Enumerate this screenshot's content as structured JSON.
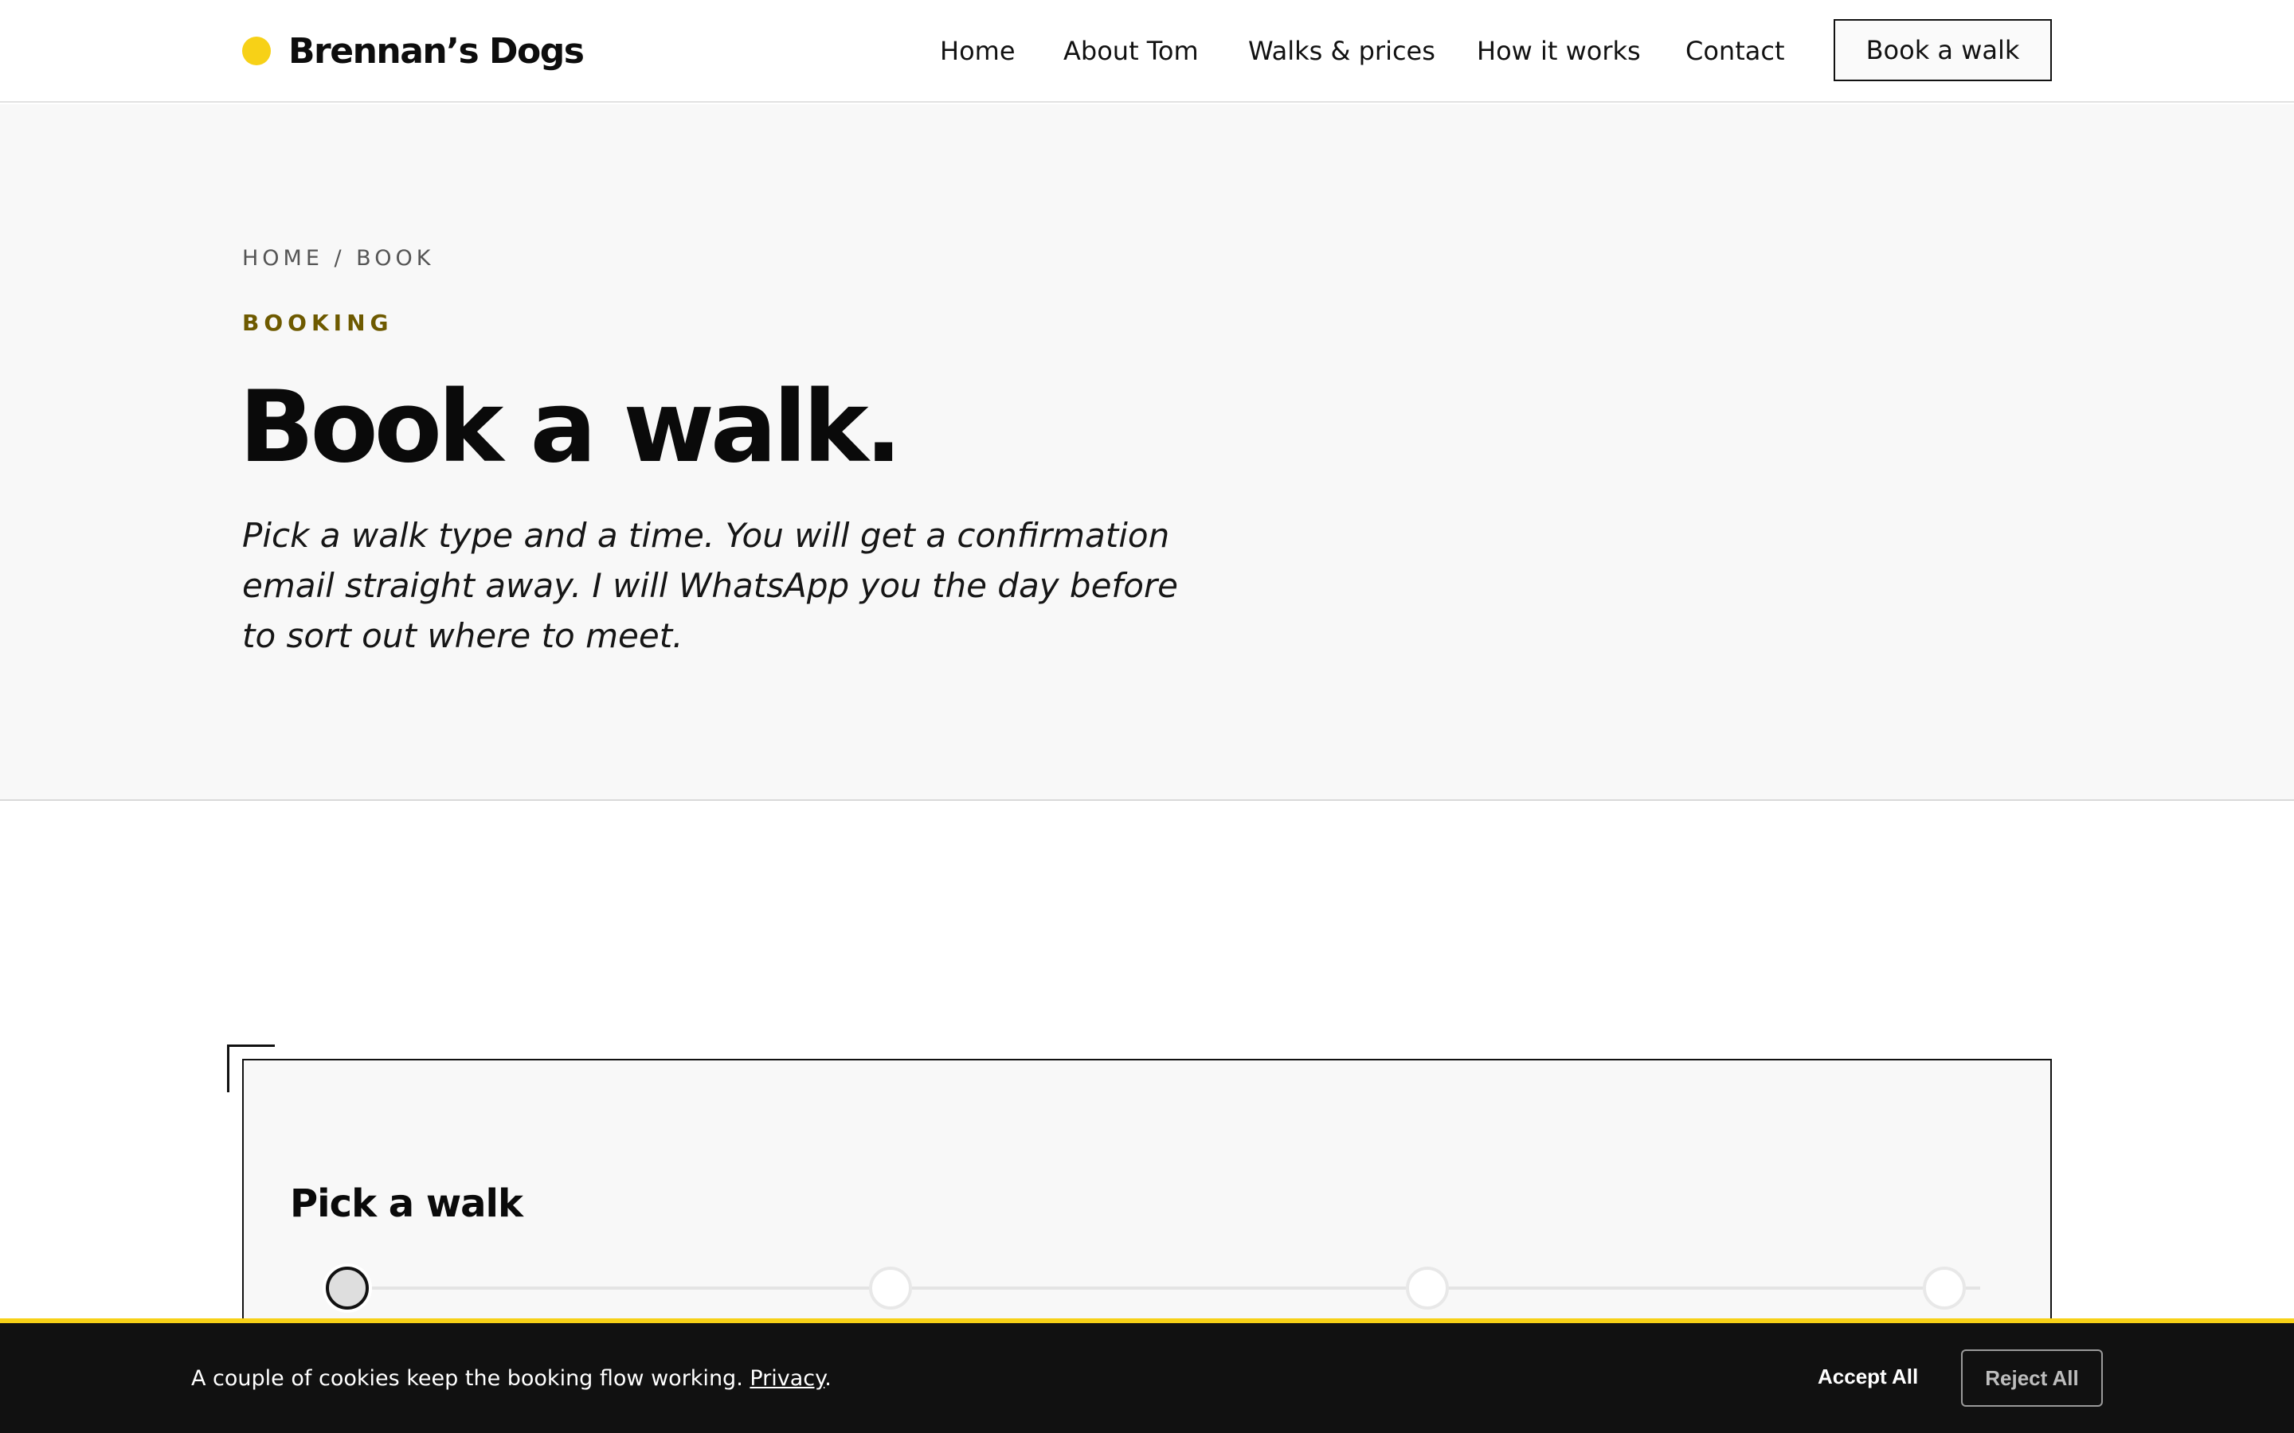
{
  "brand": {
    "name": "Brennan’s Dogs",
    "accent_color": "#f7d117"
  },
  "nav": {
    "items": [
      {
        "label": "Home"
      },
      {
        "label": "About Tom"
      },
      {
        "label": "Walks & prices"
      },
      {
        "label": "How it works"
      },
      {
        "label": "Contact"
      }
    ],
    "cta_label": "Book a walk"
  },
  "hero": {
    "breadcrumb": "HOME / BOOK",
    "eyebrow": "BOOKING",
    "title": "Book a walk.",
    "lead": "Pick a walk type and a time. You will get a confirmation email straight away. I will WhatsApp you the day before to sort out where to meet."
  },
  "booking": {
    "title": "Pick a walk",
    "steps": {
      "count": 4,
      "active_index": 0
    }
  },
  "cookie_banner": {
    "text": "A couple of cookies keep the booking flow working.",
    "link_label": "Privacy",
    "trailing": ".",
    "accept_label": "Accept All",
    "reject_label": "Reject All"
  }
}
